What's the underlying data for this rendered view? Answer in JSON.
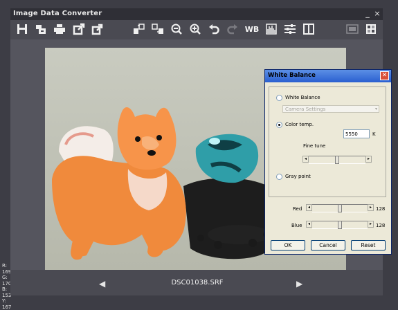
{
  "app": {
    "title": "Image Data Converter",
    "window_buttons": [
      "_",
      "×"
    ]
  },
  "toolbar": {
    "icons": [
      "save-icon",
      "open-icon",
      "print-icon",
      "export-icon",
      "batch-icon",
      "compare-icon",
      "compare-2-icon",
      "zoom-out-icon",
      "zoom-in-icon",
      "undo-icon",
      "redo-icon",
      "white-balance-icon",
      "histogram-icon",
      "levels-icon",
      "split-view-icon",
      "display-icon",
      "grid-icon"
    ],
    "wb_label": "WB"
  },
  "pixel_info": {
    "r": "R: 169",
    "g": "G: 170",
    "b": "B: 153",
    "y": "Y: 167"
  },
  "footer": {
    "filename": "DSC01038.SRF",
    "prev_symbol": "◀",
    "next_symbol": "▶"
  },
  "white_balance_dialog": {
    "title": "White Balance",
    "close_symbol": "✕",
    "options": {
      "white_balance": {
        "label": "White Balance",
        "selected": false
      },
      "preset_select": {
        "value": "Camera Settings",
        "enabled": false
      },
      "color_temp": {
        "label": "Color temp.",
        "selected": true,
        "value": "5550",
        "unit": "K"
      },
      "fine_tune_label": "Fine tune",
      "fine_tune_level": 0.5,
      "gray_point": {
        "label": "Gray point",
        "selected": false
      }
    },
    "red": {
      "label": "Red",
      "value": "128",
      "level": 0.5
    },
    "blue": {
      "label": "Blue",
      "value": "128",
      "level": 0.5
    },
    "buttons": {
      "ok": "OK",
      "cancel": "Cancel",
      "reset": "Reset"
    }
  },
  "colors": {
    "app_bg": "#3d3d45",
    "toolbar_bg": "#4a4a52",
    "dialog_bg": "#ece9d8",
    "dialog_title": "#2a5fd0"
  }
}
